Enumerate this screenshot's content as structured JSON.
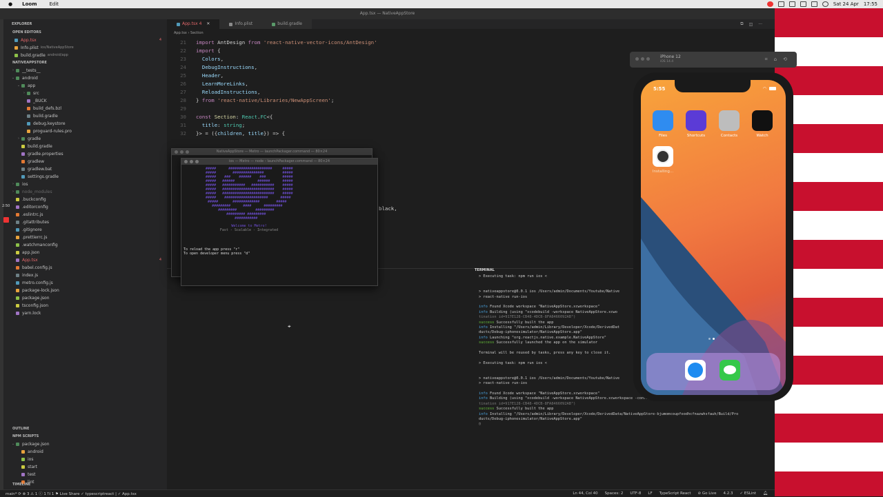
{
  "menubar": {
    "apple": "",
    "app": "Loom",
    "menu1": "Edit",
    "date": "Sat 24 Apr",
    "time": "17:55"
  },
  "window_title": "App.tsx — NativeAppStore",
  "explorer": {
    "title": "EXPLORER",
    "open_editors_title": "OPEN EDITORS",
    "open_editors": [
      {
        "label": "App.tsx",
        "desc": "",
        "badge": "4",
        "modified": true
      },
      {
        "label": "Info.plist",
        "desc": "ios/NativeAppStore"
      },
      {
        "label": "build.gradle",
        "desc": "android/app"
      }
    ],
    "project_title": "NATIVEAPPSTORE",
    "tree": [
      {
        "label": "__tests__",
        "indent": 1,
        "chev": "›"
      },
      {
        "label": "android",
        "indent": 1,
        "chev": "⌄"
      },
      {
        "label": "app",
        "indent": 2,
        "chev": "⌄"
      },
      {
        "label": "src",
        "indent": 3,
        "chev": "›"
      },
      {
        "label": "_BUCK",
        "indent": 3
      },
      {
        "label": "build_defs.bzl",
        "indent": 3
      },
      {
        "label": "build.gradle",
        "indent": 3
      },
      {
        "label": "debug.keystore",
        "indent": 3
      },
      {
        "label": "proguard-rules.pro",
        "indent": 3
      },
      {
        "label": "gradle",
        "indent": 2,
        "chev": "›"
      },
      {
        "label": "build.gradle",
        "indent": 2
      },
      {
        "label": "gradle.properties",
        "indent": 2
      },
      {
        "label": "gradlew",
        "indent": 2
      },
      {
        "label": "gradlew.bat",
        "indent": 2
      },
      {
        "label": "settings.gradle",
        "indent": 2
      },
      {
        "label": "ios",
        "indent": 1,
        "chev": "›"
      },
      {
        "label": "node_modules",
        "indent": 1,
        "chev": "›",
        "dim": true
      },
      {
        "label": ".buckconfig",
        "indent": 1
      },
      {
        "label": ".editorconfig",
        "indent": 1
      },
      {
        "label": ".eslintrc.js",
        "indent": 1
      },
      {
        "label": ".gitattributes",
        "indent": 1
      },
      {
        "label": ".gitignore",
        "indent": 1
      },
      {
        "label": ".prettierrc.js",
        "indent": 1
      },
      {
        "label": ".watchmanconfig",
        "indent": 1
      },
      {
        "label": "app.json",
        "indent": 1
      },
      {
        "label": "App.tsx",
        "indent": 1,
        "badge": "4",
        "modified": true
      },
      {
        "label": "babel.config.js",
        "indent": 1
      },
      {
        "label": "index.js",
        "indent": 1
      },
      {
        "label": "metro.config.js",
        "indent": 1
      },
      {
        "label": "package-lock.json",
        "indent": 1
      },
      {
        "label": "package.json",
        "indent": 1
      },
      {
        "label": "tsconfig.json",
        "indent": 1
      },
      {
        "label": "yarn.lock",
        "indent": 1
      }
    ],
    "outline": "OUTLINE",
    "npm_scripts": "NPM SCRIPTS",
    "npm_items": [
      "package.json",
      "android",
      "ios",
      "start",
      "test",
      "lint"
    ],
    "timeline": "TIMELINE"
  },
  "tabs": [
    {
      "label": "App.tsx 4",
      "active": true
    },
    {
      "label": "Info.plist"
    },
    {
      "label": "build.gradle"
    }
  ],
  "breadcrumb": "App.tsx  ›  Section",
  "code": [
    {
      "n": "21",
      "html": "<span class='kw'>import</span> <span class='pl'>AntDesign</span> <span class='kw'>from</span> <span class='str'>'react-native-vector-icons/AntDesign'</span>"
    },
    {
      "n": "22",
      "html": "<span class='kw'>import</span> <span class='pl'>{</span>"
    },
    {
      "n": "23",
      "html": "  <span class='var'>Colors</span><span class='pl'>,</span>"
    },
    {
      "n": "24",
      "html": "  <span class='var'>DebugInstructions</span><span class='pl'>,</span>"
    },
    {
      "n": "25",
      "html": "  <span class='var'>Header</span><span class='pl'>,</span>"
    },
    {
      "n": "26",
      "html": "  <span class='var'>LearnMoreLinks</span><span class='pl'>,</span>"
    },
    {
      "n": "27",
      "html": "  <span class='var'>ReloadInstructions</span><span class='pl'>,</span>"
    },
    {
      "n": "28",
      "html": "<span class='pl'>}</span> <span class='kw'>from</span> <span class='str'>'react-native/Libraries/NewAppScreen'</span><span class='pl'>;</span>"
    },
    {
      "n": "29",
      "html": ""
    },
    {
      "n": "30",
      "html": "<span class='kw'>const</span> <span class='fn'>Section</span><span class='pl'>:</span> <span class='typ'>React</span><span class='pl'>.</span><span class='typ'>FC</span><span class='pl'>&lt;{</span>"
    },
    {
      "n": "31",
      "html": "  <span class='var'>title</span><span class='pl'>:</span> <span class='typ'>string</span><span class='pl'>;</span>"
    },
    {
      "n": "32",
      "html": "<span class='pl'>}&gt; = ({</span><span class='var'>children</span><span class='pl'>,</span> <span class='var'>title</span><span class='pl'>}) =&gt; {</span>"
    }
  ],
  "code_fragment": "black,",
  "metro": {
    "win1_title": "NativeAppStore — Metro — launchPackager.command — 80×24",
    "win2_title": "ios — Metro — node ‹ launchPackager.command — 80×24",
    "welcome": "Welcome to Metro!",
    "tagline": "Fast - Scalable - Integrated",
    "reload": "To reload the app press \"r\"",
    "devmenu": "To open developer menu press \"d\""
  },
  "terminal": {
    "title": "TERMINAL",
    "lines": [
      {
        "t": "> Executing task: npm run ios <"
      },
      {
        "t": ""
      },
      {
        "t": ""
      },
      {
        "t": "> nativeappstore@0.0.1 ios /Users/admin/Documents/Youtube/Native"
      },
      {
        "t": "> react-native run-ios"
      },
      {
        "t": ""
      },
      {
        "t": "info Found Xcode workspace \"NativeAppStore.xcworkspace\"",
        "k": "info"
      },
      {
        "t": "info Building (using \"xcodebuild -workspace NativeAppStore.xcwo",
        "k": "info"
      },
      {
        "t": "tination id=917E128-CB48-4DCB-8FA8466092AB\")",
        "k": "gry"
      },
      {
        "t": "success Successfully built the app",
        "k": "ok"
      },
      {
        "t": "info Installing \"/Users/admin/Library/Developer/Xcode/DerivedDat",
        "k": "info"
      },
      {
        "t": "ducts/Debug-iphonesimulator/NativeAppStore.app\""
      },
      {
        "t": "info Launching \"org.reactjs.native.example.NativeAppStore\"",
        "k": "info"
      },
      {
        "t": "success Successfully launched the app on the simulator",
        "k": "ok"
      },
      {
        "t": ""
      },
      {
        "t": "Terminal will be reused by tasks, press any key to close it."
      },
      {
        "t": ""
      },
      {
        "t": "> Executing task: npm run ios <"
      },
      {
        "t": ""
      },
      {
        "t": ""
      },
      {
        "t": "> nativeappstore@0.0.1 ios /Users/admin/Documents/Youtube/Native"
      },
      {
        "t": "> react-native run-ios"
      },
      {
        "t": ""
      },
      {
        "t": "info Found Xcode workspace \"NativeAppStore.xcworkspace\"",
        "k": "info"
      },
      {
        "t": "info Building (using \"xcodebuild -workspace NativeAppStore.xcworkspace -configuration Debug -scheme NativeAppStore -des",
        "k": "info"
      },
      {
        "t": "tination id=917E128-CB48-4DCB-8FA8466092AB\")",
        "k": "gry"
      },
      {
        "t": "success Successfully built the app",
        "k": "ok"
      },
      {
        "t": "info Installing \"/Users/admin/Library/Developer/Xcode/DerivedData/NativeAppStore-bjumomcoupfoodhcfnazwhsfauh/Build/Pro",
        "k": "info"
      },
      {
        "t": "ducts/Debug-iphonesimulator/NativeAppStore.app\""
      },
      {
        "t": "▯"
      }
    ]
  },
  "simulator": {
    "device": "iPhone 12",
    "os": "iOS 14.4",
    "clock": "5:55",
    "apps": [
      {
        "label": "Files",
        "color": "#2f8cf0"
      },
      {
        "label": "Shortcuts",
        "color": "#5b3bd6"
      },
      {
        "label": "Contacts",
        "color": "#bdbdbd"
      },
      {
        "label": "Watch",
        "color": "#111111"
      }
    ],
    "installing": "Installing..."
  },
  "statusbar": {
    "left": "main*  ⟳  ⊗ 3 ⚠ 1 ⓘ 1   ⮁ 1   ⚑ Live Share   ✓ typescriptreact  |  ✓ App.tsx",
    "position": "Ln 44, Col 40",
    "spaces": "Spaces: 2",
    "encoding": "UTF-8",
    "eol": "LF",
    "language": "TypeScript React",
    "golive": "⊘ Go Live",
    "version": "4.2.3",
    "eslint": "✓ ESLint"
  }
}
